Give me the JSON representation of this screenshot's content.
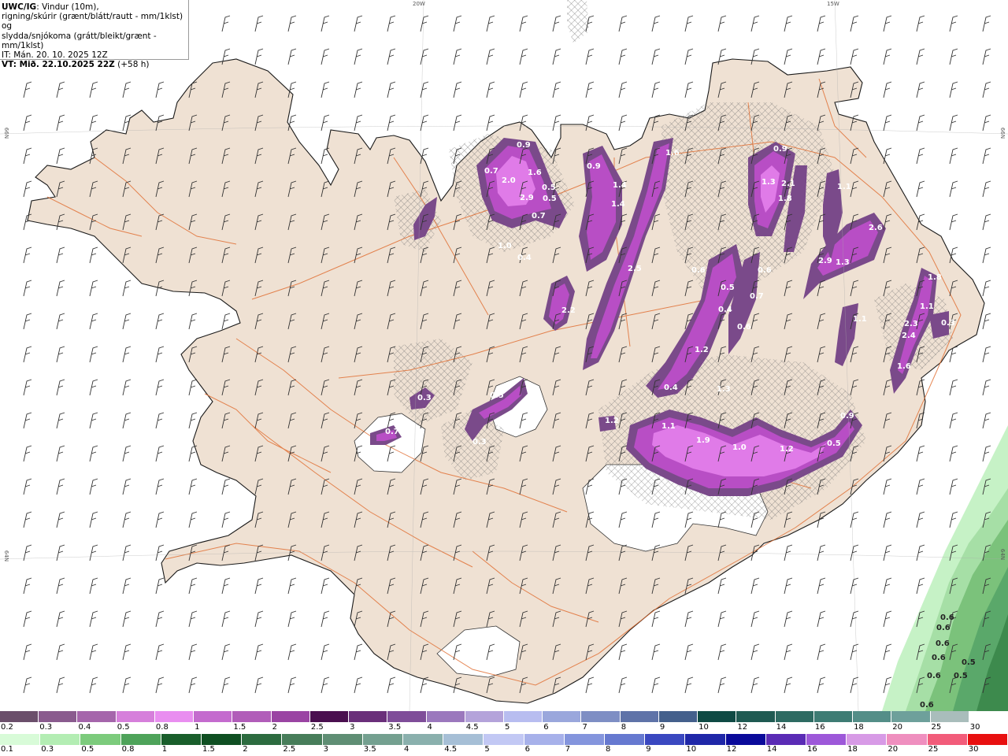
{
  "header": {
    "model": "UWC/IG",
    "line1_rest": ": Vindur (10m),",
    "line2": "rigning/skúrir (grænt/blátt/rautt - mm/1klst) og",
    "line3": "slydda/snjókoma (grátt/bleikt/grænt - mm/1klst)",
    "line4": "IT: Mán. 20. 10. 2025 12Z",
    "vt_label": "VT: Mið. 22.10.2025 22Z",
    "vt_offset": " (+58 h)"
  },
  "grid_labels": {
    "top_20w": "20W",
    "top_15w": "15W",
    "left_66n": "66N",
    "left_64n": "64N",
    "right_66n": "66N",
    "right_64n": "64N"
  },
  "colors": {
    "land": "#efe1d3",
    "ocean": "#ffffff",
    "glacier": "#ffffff",
    "roads": "#e06a2c",
    "snow_light": "#7a4a8a",
    "snow_mid": "#b84ec5",
    "snow_heavy": "#e07be8",
    "rain_light": "#c6f2c6",
    "rain_mid": "#7bc27b",
    "rain_heavy": "#3d8a4d"
  },
  "snow_labels": [
    {
      "v": "0.9"
    },
    {
      "v": "0.7"
    },
    {
      "v": "1.6"
    },
    {
      "v": "2.0"
    },
    {
      "v": "2.9"
    },
    {
      "v": "0.5"
    },
    {
      "v": "0.7"
    },
    {
      "v": "1.0"
    },
    {
      "v": "0.4"
    },
    {
      "v": "0.9"
    },
    {
      "v": "1.4"
    },
    {
      "v": "1.4"
    },
    {
      "v": "1.6"
    },
    {
      "v": "2.5"
    },
    {
      "v": "2.2"
    },
    {
      "v": "0.9"
    },
    {
      "v": "1.3"
    },
    {
      "v": "2.1"
    },
    {
      "v": "1.8"
    },
    {
      "v": "1.1"
    },
    {
      "v": "2.6"
    },
    {
      "v": "1.3"
    },
    {
      "v": "2.9"
    },
    {
      "v": "1.8"
    },
    {
      "v": "1.1"
    },
    {
      "v": "2.3"
    },
    {
      "v": "2.4"
    },
    {
      "v": "1.6"
    },
    {
      "v": "0.3"
    },
    {
      "v": "1.1"
    },
    {
      "v": "1.2"
    },
    {
      "v": "0.4"
    },
    {
      "v": "1.3"
    },
    {
      "v": "0.6"
    },
    {
      "v": "0.5"
    },
    {
      "v": "0.4"
    },
    {
      "v": "0.6"
    },
    {
      "v": "0.7"
    },
    {
      "v": "1.1"
    },
    {
      "v": "1.9"
    },
    {
      "v": "1.0"
    },
    {
      "v": "1.2"
    },
    {
      "v": "0.9"
    },
    {
      "v": "0.5"
    },
    {
      "v": "0.3"
    },
    {
      "v": "0.5"
    },
    {
      "v": "0.3"
    },
    {
      "v": "0.7"
    },
    {
      "v": "1.2"
    },
    {
      "v": "0.5"
    },
    {
      "v": "0.6"
    }
  ],
  "rain_labels": [
    {
      "v": "0.6"
    },
    {
      "v": "0.6"
    },
    {
      "v": "0.6"
    },
    {
      "v": "0.6"
    },
    {
      "v": "0.5"
    },
    {
      "v": "0.6"
    },
    {
      "v": "0.5"
    },
    {
      "v": "0.6"
    }
  ],
  "legend_snow": {
    "labels": [
      "0.2",
      "0.3",
      "0.4",
      "0.5",
      "0.8",
      "1",
      "1.5",
      "2",
      "2.5",
      "3",
      "3.5",
      "4",
      "4.5",
      "5",
      "6",
      "7",
      "8",
      "9",
      "10",
      "12",
      "14",
      "16",
      "18",
      "20",
      "25",
      "30"
    ],
    "colors": [
      "#6b4f6b",
      "#8a5b8e",
      "#a565ab",
      "#d67fdb",
      "#e98ef0",
      "#c46bce",
      "#b15db9",
      "#9a44a3",
      "#4a0f4f",
      "#6a2f7a",
      "#7f4d99",
      "#9b78bd",
      "#b4a3da",
      "#b8bdf0",
      "#9aa7dc",
      "#7e8ec4",
      "#5f73a8",
      "#44608c",
      "#0f4a44",
      "#1f5a52",
      "#2e6b62",
      "#3e7c74",
      "#548e88",
      "#6ea09b",
      "#a9bdbb",
      "#ffffff"
    ]
  },
  "legend_rain": {
    "labels": [
      "0.1",
      "0.3",
      "0.5",
      "0.8",
      "1",
      "1.5",
      "2",
      "2.5",
      "3",
      "3.5",
      "4",
      "4.5",
      "5",
      "6",
      "7",
      "8",
      "9",
      "10",
      "12",
      "14",
      "16",
      "18",
      "20",
      "25",
      "30"
    ],
    "colors": [
      "#d8fbd8",
      "#b3edb3",
      "#7ccb7c",
      "#4ea35a",
      "#195e2b",
      "#0f4f22",
      "#2c6b3f",
      "#477d5a",
      "#5f8e74",
      "#74a090",
      "#8ab0ad",
      "#a6bfd6",
      "#c2c8f4",
      "#a7b1ea",
      "#8495dd",
      "#6679d0",
      "#3a48c0",
      "#1f27a8",
      "#0a0a9a",
      "#5a2bb5",
      "#9d58d9",
      "#d79ae6",
      "#ef8fbf",
      "#f25c7a",
      "#e81010"
    ]
  }
}
